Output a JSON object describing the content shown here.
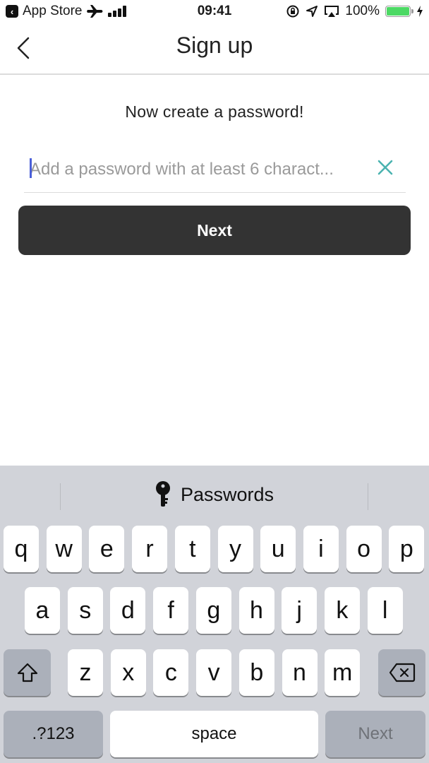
{
  "status_bar": {
    "back_app": "App Store",
    "time": "09:41",
    "battery": "100%",
    "battery_level_percent": 100,
    "icons": [
      "back-arrow-icon",
      "airplane-icon",
      "signal-icon",
      "orientation-lock-icon",
      "location-icon",
      "airplay-icon",
      "battery-icon",
      "charging-bolt-icon"
    ]
  },
  "nav": {
    "title": "Sign up",
    "back_icon": "chevron-left-icon"
  },
  "form": {
    "prompt": "Now create a password!",
    "password_placeholder": "Add a password with at least 6 charact...",
    "password_value": "",
    "clear_icon": "close-icon",
    "next_label": "Next"
  },
  "colors": {
    "accent_clear": "#4bb3b0",
    "button_bg": "#333333",
    "caret": "#4a5fd8",
    "keyboard_bg": "#d1d3d9"
  },
  "keyboard": {
    "suggestion": "Passwords",
    "suggestion_icon": "key-icon",
    "row1": [
      "q",
      "w",
      "e",
      "r",
      "t",
      "y",
      "u",
      "i",
      "o",
      "p"
    ],
    "row2": [
      "a",
      "s",
      "d",
      "f",
      "g",
      "h",
      "j",
      "k",
      "l"
    ],
    "row3": [
      "z",
      "x",
      "c",
      "v",
      "b",
      "n",
      "m"
    ],
    "shift_icon": "shift-icon",
    "delete_icon": "backspace-icon",
    "numbers_label": ".?123",
    "space_label": "space",
    "return_label": "Next"
  }
}
